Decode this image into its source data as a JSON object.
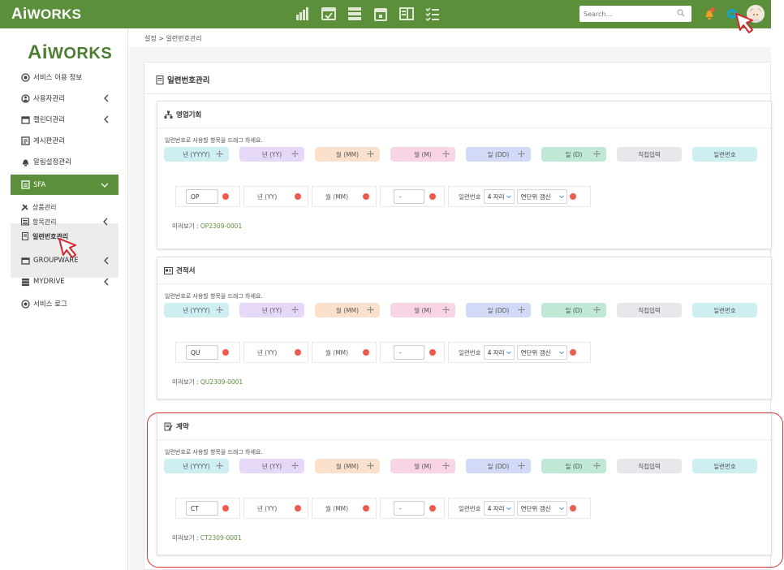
{
  "header": {
    "logo_ai": "Ai",
    "logo_text": "WORKS",
    "search_placeholder": "Search...",
    "icons": [
      "chart-icon",
      "schedule-icon",
      "storage-icon",
      "calendar-icon",
      "board-icon",
      "checklist-icon"
    ],
    "colors": {
      "primary": "#5b8f3a",
      "badge": "#f0a020",
      "accent": "#1aa3c7"
    }
  },
  "sidebar": {
    "logo_ai": "Ai",
    "logo_text": "WORKS",
    "items": [
      {
        "label": "서비스 이용 정보",
        "icon": "info-icon",
        "chevron": false
      },
      {
        "label": "사용자관리",
        "icon": "users-icon",
        "chevron": true
      },
      {
        "label": "캘린더관리",
        "icon": "calendar-icon",
        "chevron": true
      },
      {
        "label": "게시판관리",
        "icon": "board-icon",
        "chevron": false
      },
      {
        "label": "알림설정관리",
        "icon": "bell-icon",
        "chevron": false
      },
      {
        "label": "SFA",
        "icon": "sfa-icon",
        "chevron": true,
        "active": true
      },
      {
        "label": "GROUPWARE",
        "icon": "groupware-icon",
        "chevron": true
      },
      {
        "label": "MYDRIVE",
        "icon": "drive-icon",
        "chevron": true
      },
      {
        "label": "서비스 로그",
        "icon": "log-icon",
        "chevron": false
      }
    ],
    "sfa_sub": [
      {
        "label": "상품관리",
        "icon": "tools-icon"
      },
      {
        "label": "항목관리",
        "icon": "list-icon",
        "chevron": true
      },
      {
        "label": "일련번호관리",
        "icon": "serial-icon",
        "current": true
      }
    ]
  },
  "breadcrumb": "설정 > 일련번호관리",
  "page_title": "일련번호관리",
  "hint": "일련번호로 사용할 항목을 드래그 하세요.",
  "chips": [
    {
      "label": "년 (YYYY)",
      "color": "#cdeff2"
    },
    {
      "label": "년 (YY)",
      "color": "#e6d9f7"
    },
    {
      "label": "월 (MM)",
      "color": "#fbe0cc"
    },
    {
      "label": "월 (M)",
      "color": "#f9d3e6"
    },
    {
      "label": "일 (DD)",
      "color": "#d3daf7"
    },
    {
      "label": "일 (D)",
      "color": "#bfe9d4"
    },
    {
      "label": "직접입력",
      "color": "#e8e8ec"
    },
    {
      "label": "일련번호",
      "color": "#cdeff2"
    }
  ],
  "slot_labels": {
    "year": "년 (YY)",
    "month": "월 (MM)",
    "serial": "일련번호",
    "digits": "4 자리",
    "reset": "연단위 갱신",
    "separator": "-"
  },
  "preview_label": "미리보기 :",
  "sections": [
    {
      "title": "영업기회",
      "icon": "sitemap-icon",
      "prefix": "OP",
      "preview": "OP2309-0001"
    },
    {
      "title": "견적서",
      "icon": "estimate-icon",
      "prefix": "QU",
      "preview": "QU2309-0001"
    },
    {
      "title": "계약",
      "icon": "contract-icon",
      "prefix": "CT",
      "preview": "CT2309-0001"
    }
  ]
}
